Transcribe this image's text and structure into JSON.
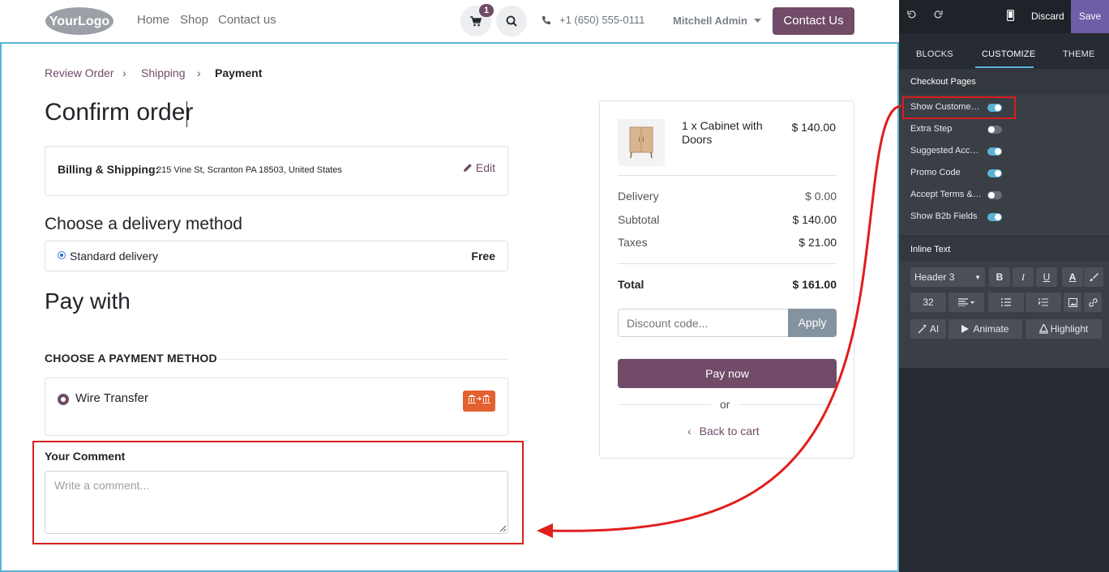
{
  "header": {
    "logo_text": "YourLogo",
    "nav": [
      "Home",
      "Shop",
      "Contact us"
    ],
    "cart_count": "1",
    "phone": "+1 (650) 555-0111",
    "user": "Mitchell Admin",
    "contact_button": "Contact Us"
  },
  "breadcrumb": {
    "step1": "Review Order",
    "step2": "Shipping",
    "step3": "Payment"
  },
  "main": {
    "title": "Confirm order",
    "billing_label": "Billing & Shipping:",
    "billing_address": "215 Vine St, Scranton PA 18503, United States",
    "edit_label": "Edit",
    "delivery_heading": "Choose a delivery method",
    "delivery_name": "Standard delivery",
    "delivery_price": "Free",
    "pay_heading": "Pay with",
    "payment_method_heading": "CHOOSE A PAYMENT METHOD",
    "payment_method": "Wire Transfer",
    "comment_label": "Your Comment",
    "comment_placeholder": "Write a comment..."
  },
  "summary": {
    "product": "1 x Cabinet with Doors",
    "product_price": "$ 140.00",
    "delivery_label": "Delivery",
    "delivery_value": "$ 0.00",
    "subtotal_label": "Subtotal",
    "subtotal_value": "$ 140.00",
    "taxes_label": "Taxes",
    "taxes_value": "$ 21.00",
    "total_label": "Total",
    "total_value": "$ 161.00",
    "discount_placeholder": "Discount code...",
    "apply_label": "Apply",
    "pay_now": "Pay now",
    "or": "or",
    "back_to_cart": "Back to cart"
  },
  "panel": {
    "discard": "Discard",
    "save": "Save",
    "tabs": [
      "BLOCKS",
      "CUSTOMIZE",
      "THEME"
    ],
    "section1_title": "Checkout Pages",
    "options": [
      {
        "label": "Show Customer ...",
        "on": true
      },
      {
        "label": "Extra Step",
        "on": false
      },
      {
        "label": "Suggested Acce...",
        "on": true
      },
      {
        "label": "Promo Code",
        "on": true
      },
      {
        "label": "Accept Terms & ...",
        "on": false
      },
      {
        "label": "Show B2b Fields",
        "on": true
      }
    ],
    "section2_title": "Inline Text",
    "heading_select": "Header 3",
    "font_size": "32",
    "ai_label": "AI",
    "animate_label": "Animate",
    "highlight_label": "Highlight"
  },
  "colors": {
    "brand": "#714b67",
    "accent": "#5ab3d6",
    "highlight_red": "#d81f1f",
    "save": "#6e5da7"
  }
}
